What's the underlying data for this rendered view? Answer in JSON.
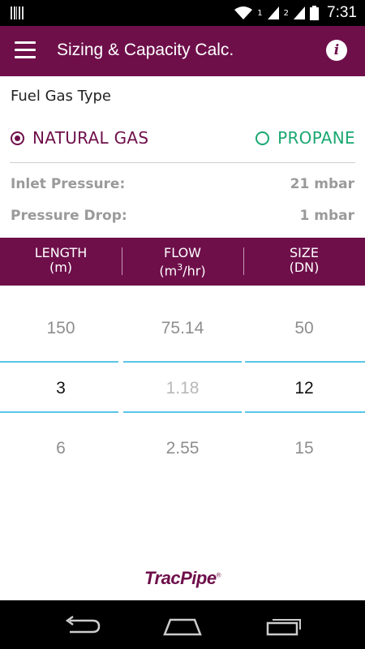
{
  "status_bar": {
    "time": "7:31",
    "sim1": "1",
    "sim2": "2"
  },
  "app_bar": {
    "title": "Sizing & Capacity Calc.",
    "menu_icon": "menu-icon",
    "info_icon": "info-icon",
    "info_glyph": "i"
  },
  "fuel_gas": {
    "title": "Fuel Gas Type",
    "options": [
      {
        "label": "NATURAL GAS",
        "selected": true
      },
      {
        "label": "PROPANE",
        "selected": false
      }
    ]
  },
  "params": {
    "inlet_label": "Inlet Pressure:",
    "inlet_value": "21 mbar",
    "drop_label": "Pressure Drop:",
    "drop_value": "1 mbar"
  },
  "table": {
    "headers": [
      {
        "line1": "LENGTH",
        "line2": "(m)"
      },
      {
        "line1": "FLOW",
        "line2_pre": "(m",
        "line2_sup": "3",
        "line2_post": "/hr)"
      },
      {
        "line1": "SIZE",
        "line2": "(DN)"
      }
    ],
    "columns": [
      {
        "above": "150",
        "selected": "3",
        "below": "6"
      },
      {
        "above": "75.14",
        "selected": "1.18",
        "below": "2.55"
      },
      {
        "above": "50",
        "selected": "12",
        "below": "15"
      }
    ]
  },
  "logo": {
    "text": "TracPipe",
    "mark": "®"
  },
  "colors": {
    "brand": "#6e0f4a",
    "propane": "#1aa871",
    "selection_line": "#5bc5e8"
  }
}
